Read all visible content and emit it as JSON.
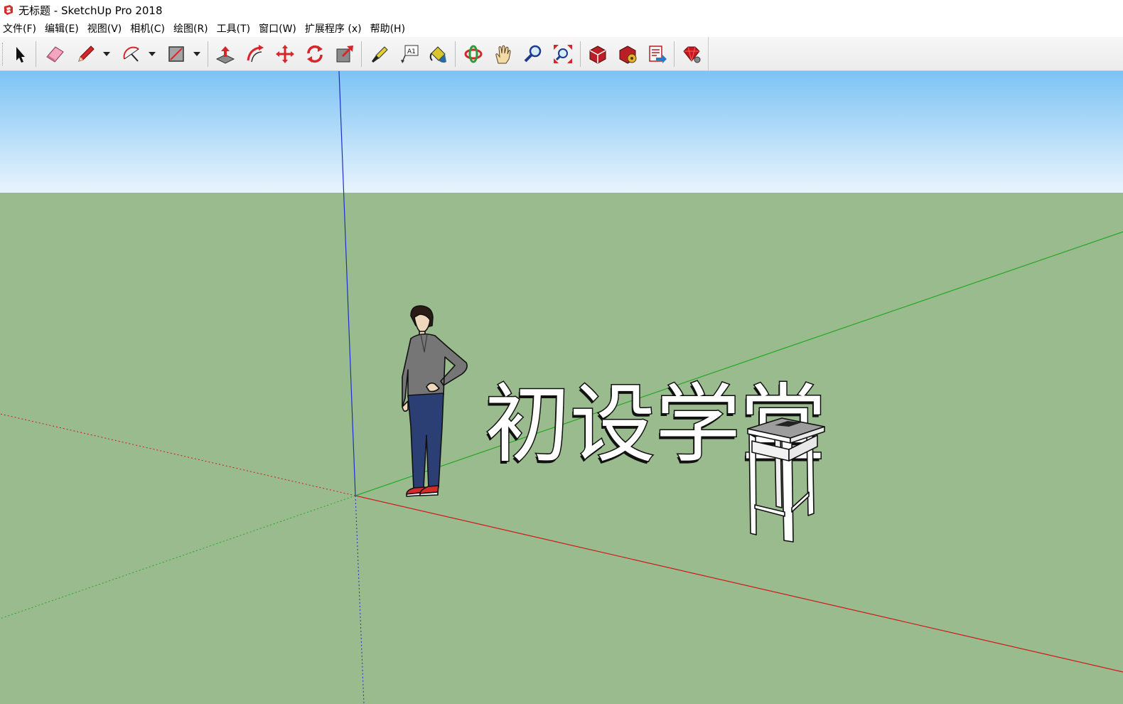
{
  "window": {
    "title": "无标题 - SketchUp Pro 2018"
  },
  "menu": [
    "文件(F)",
    "编辑(E)",
    "视图(V)",
    "相机(C)",
    "绘图(R)",
    "工具(T)",
    "窗口(W)",
    "扩展程序 (x)",
    "帮助(H)"
  ],
  "toolbar": {
    "tools": [
      "select",
      "eraser",
      "line",
      "arc",
      "rectangle",
      "push-pull",
      "offset",
      "move",
      "rotate",
      "scale",
      "tape-measure",
      "text",
      "paint-bucket",
      "orbit",
      "pan",
      "zoom",
      "zoom-extents",
      "3d-warehouse",
      "extension-warehouse",
      "send-to-layout",
      "extension-manager"
    ]
  },
  "scene": {
    "sky_colors": [
      "#7cc3f4",
      "#e9f4fd"
    ],
    "ground_color": "#9abb8e",
    "axis_colors": {
      "red": "#cc1a1a",
      "green": "#22a822",
      "blue": "#1e2ec8"
    },
    "text_3d": "初设学堂"
  }
}
